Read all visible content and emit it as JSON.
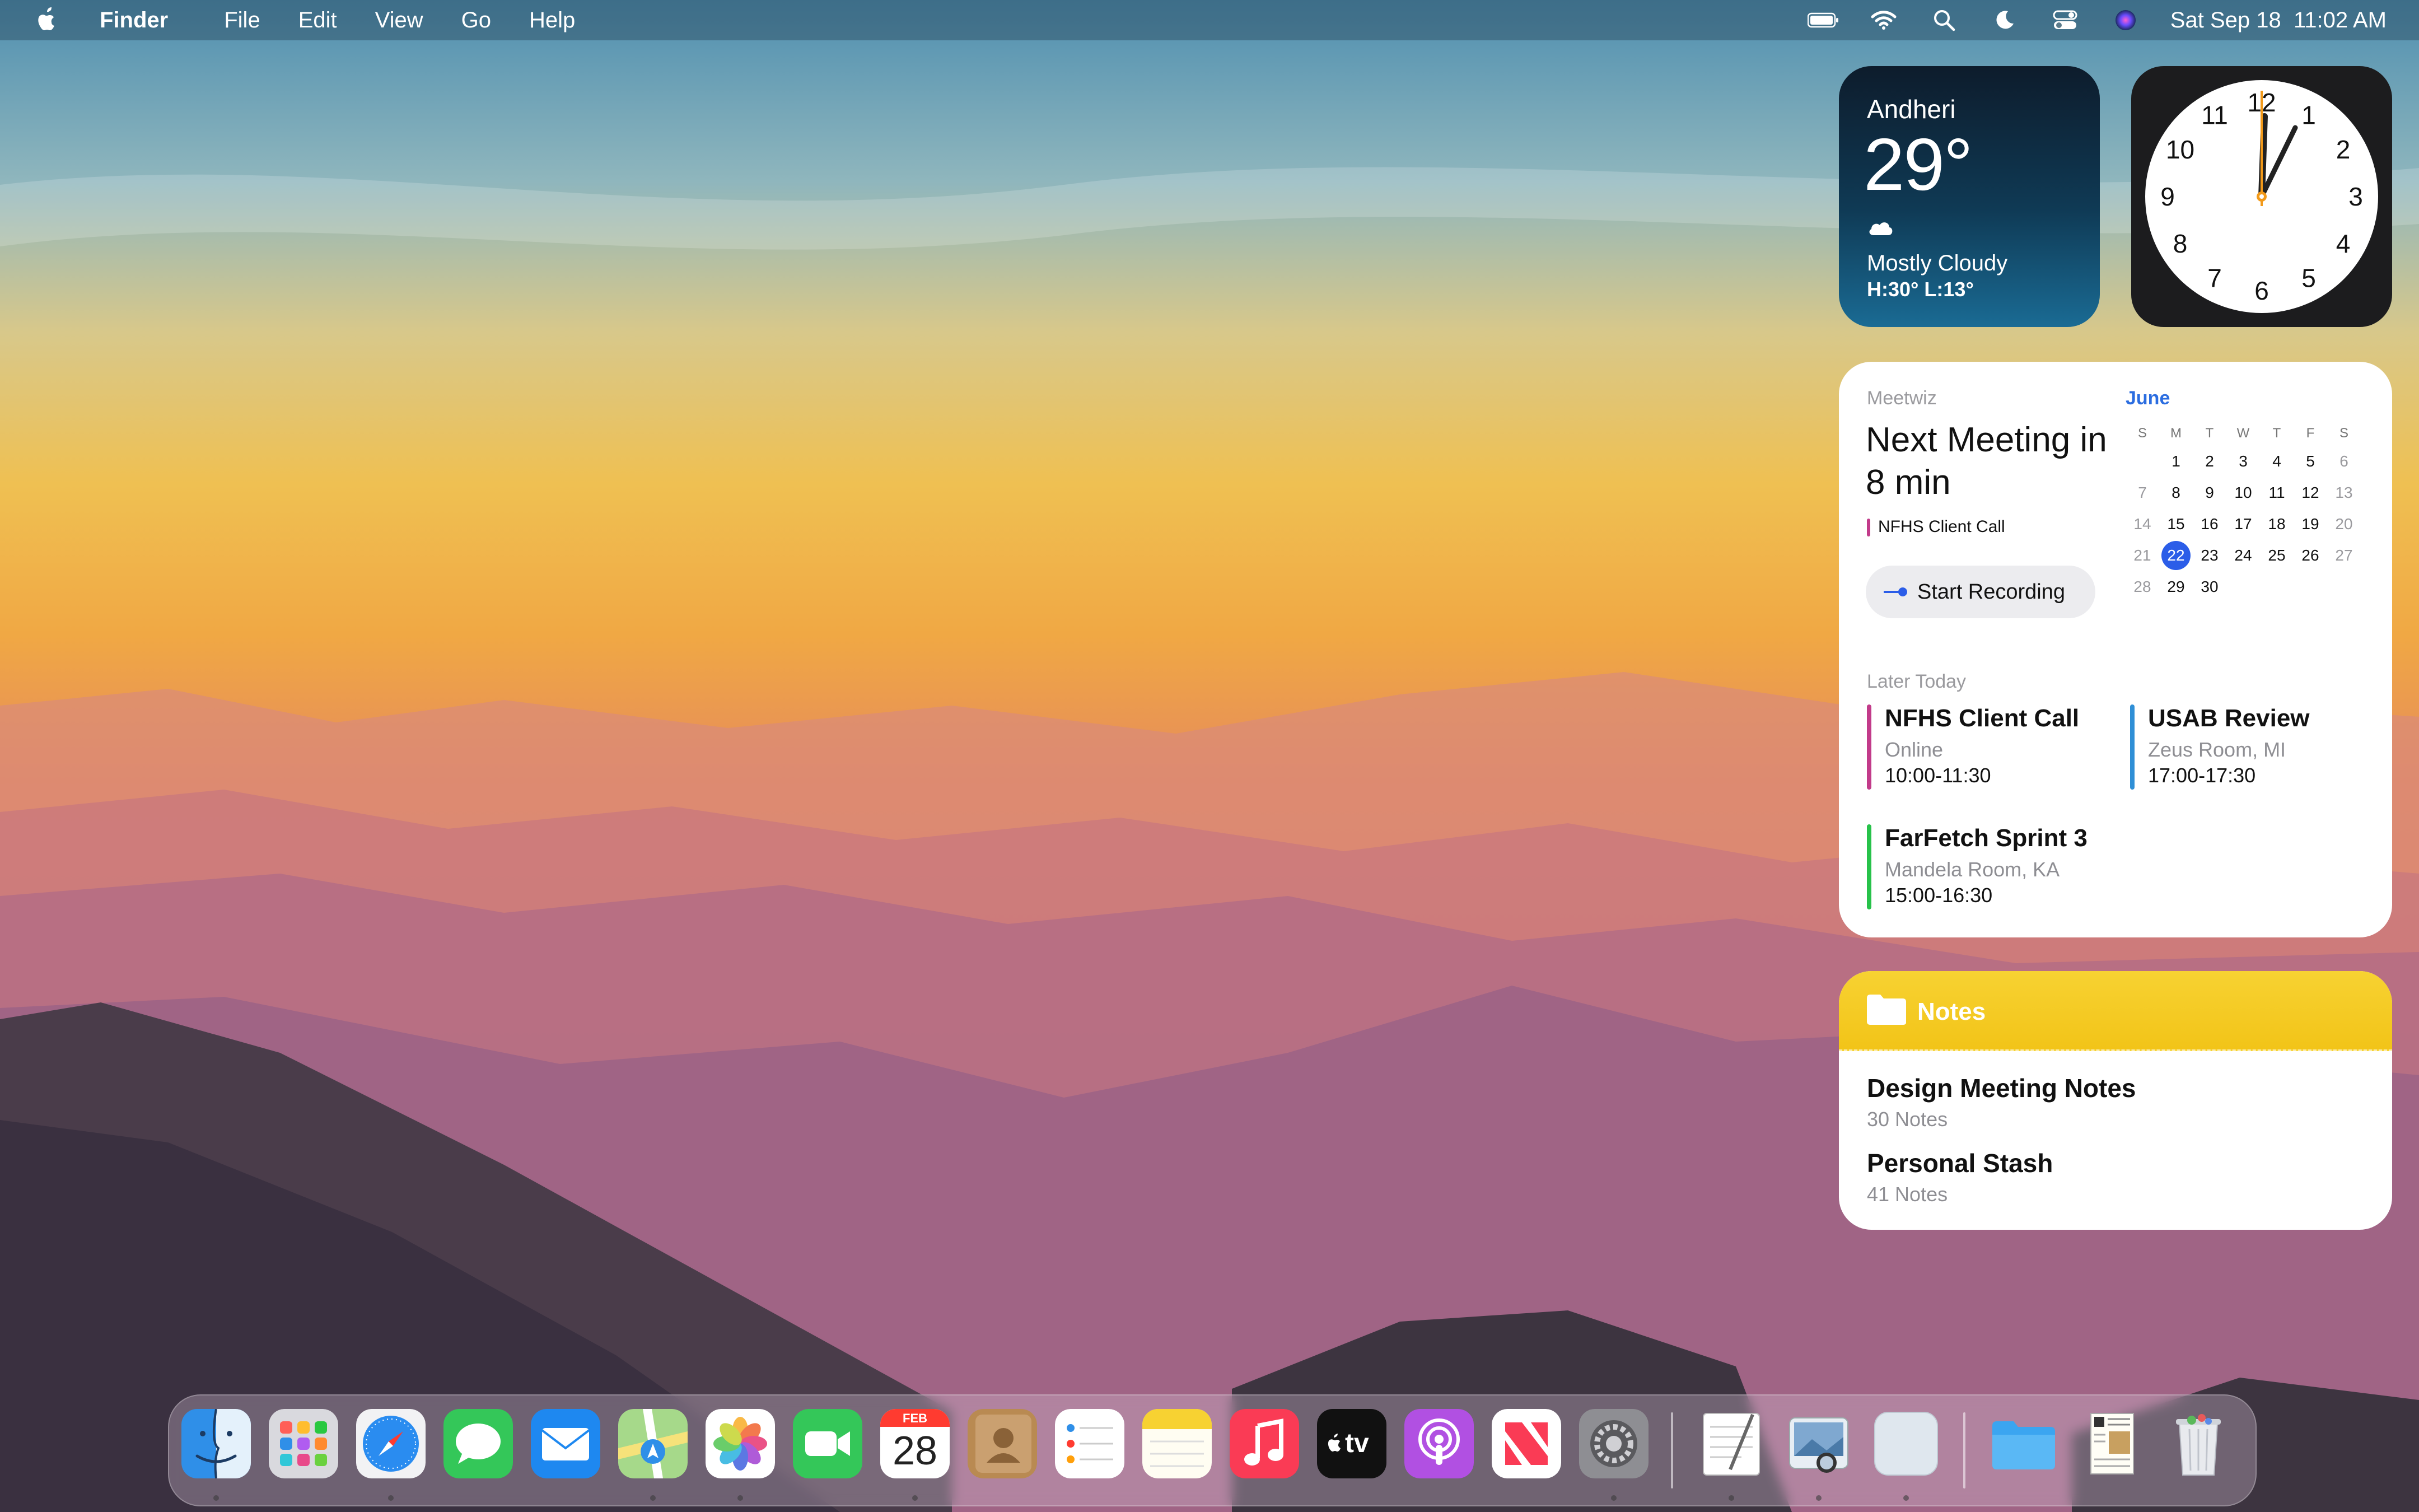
{
  "menubar": {
    "app_name": "Finder",
    "menus": [
      "File",
      "Edit",
      "View",
      "Go",
      "Help"
    ],
    "datetime": "Sat Sep 18  11:02 AM"
  },
  "weather": {
    "city": "Andheri",
    "temperature": "29°",
    "condition": "Mostly Cloudy",
    "high_low": "H:30° L:13°"
  },
  "clock": {
    "numbers": [
      "12",
      "1",
      "2",
      "3",
      "4",
      "5",
      "6",
      "7",
      "8",
      "9",
      "10",
      "11"
    ]
  },
  "meeting": {
    "app": "Meetwiz",
    "next": "Next Meeting in 8 min",
    "call": "NFHS Client Call",
    "record_label": "Start Recording",
    "month": "June",
    "weekdays": [
      "S",
      "M",
      "T",
      "W",
      "T",
      "F",
      "S"
    ],
    "weeks": [
      [
        "",
        "1",
        "2",
        "3",
        "4",
        "5",
        "6"
      ],
      [
        "7",
        "8",
        "9",
        "10",
        "11",
        "12",
        "13"
      ],
      [
        "14",
        "15",
        "16",
        "17",
        "18",
        "19",
        "20"
      ],
      [
        "21",
        "22",
        "23",
        "24",
        "25",
        "26",
        "27"
      ],
      [
        "28",
        "29",
        "30",
        "",
        "",
        "",
        ""
      ]
    ],
    "today": "22",
    "later_label": "Later Today",
    "events": [
      {
        "title": "NFHS Client Call",
        "location": "Online",
        "time": "10:00-11:30",
        "color": "#c23b8a"
      },
      {
        "title": "USAB Review",
        "location": "Zeus Room, MI",
        "time": "17:00-17:30",
        "color": "#2f8fd6"
      },
      {
        "title": "FarFetch Sprint 3",
        "location": "Mandela Room, KA",
        "time": "15:00-16:30",
        "color": "#27c24a"
      }
    ]
  },
  "notes": {
    "title": "Notes",
    "items": [
      {
        "name": "Design Meeting Notes",
        "count": "30 Notes"
      },
      {
        "name": "Personal Stash",
        "count": "41 Notes"
      }
    ]
  },
  "dock": {
    "calendar_month": "FEB",
    "calendar_day": "28",
    "tv_label": "tv"
  }
}
